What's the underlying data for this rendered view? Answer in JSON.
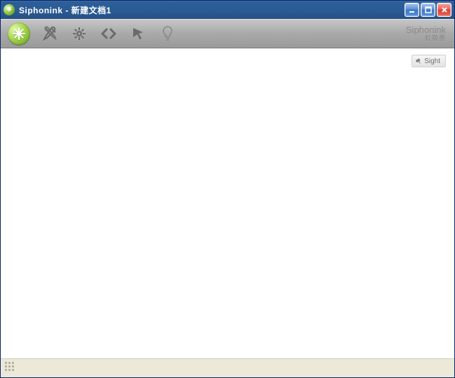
{
  "window": {
    "title": "Siphonink - 新建文档1"
  },
  "brand": {
    "name": "Siphonink",
    "sub": "虹吸墨"
  },
  "panel": {
    "sight_label": "Sight"
  }
}
